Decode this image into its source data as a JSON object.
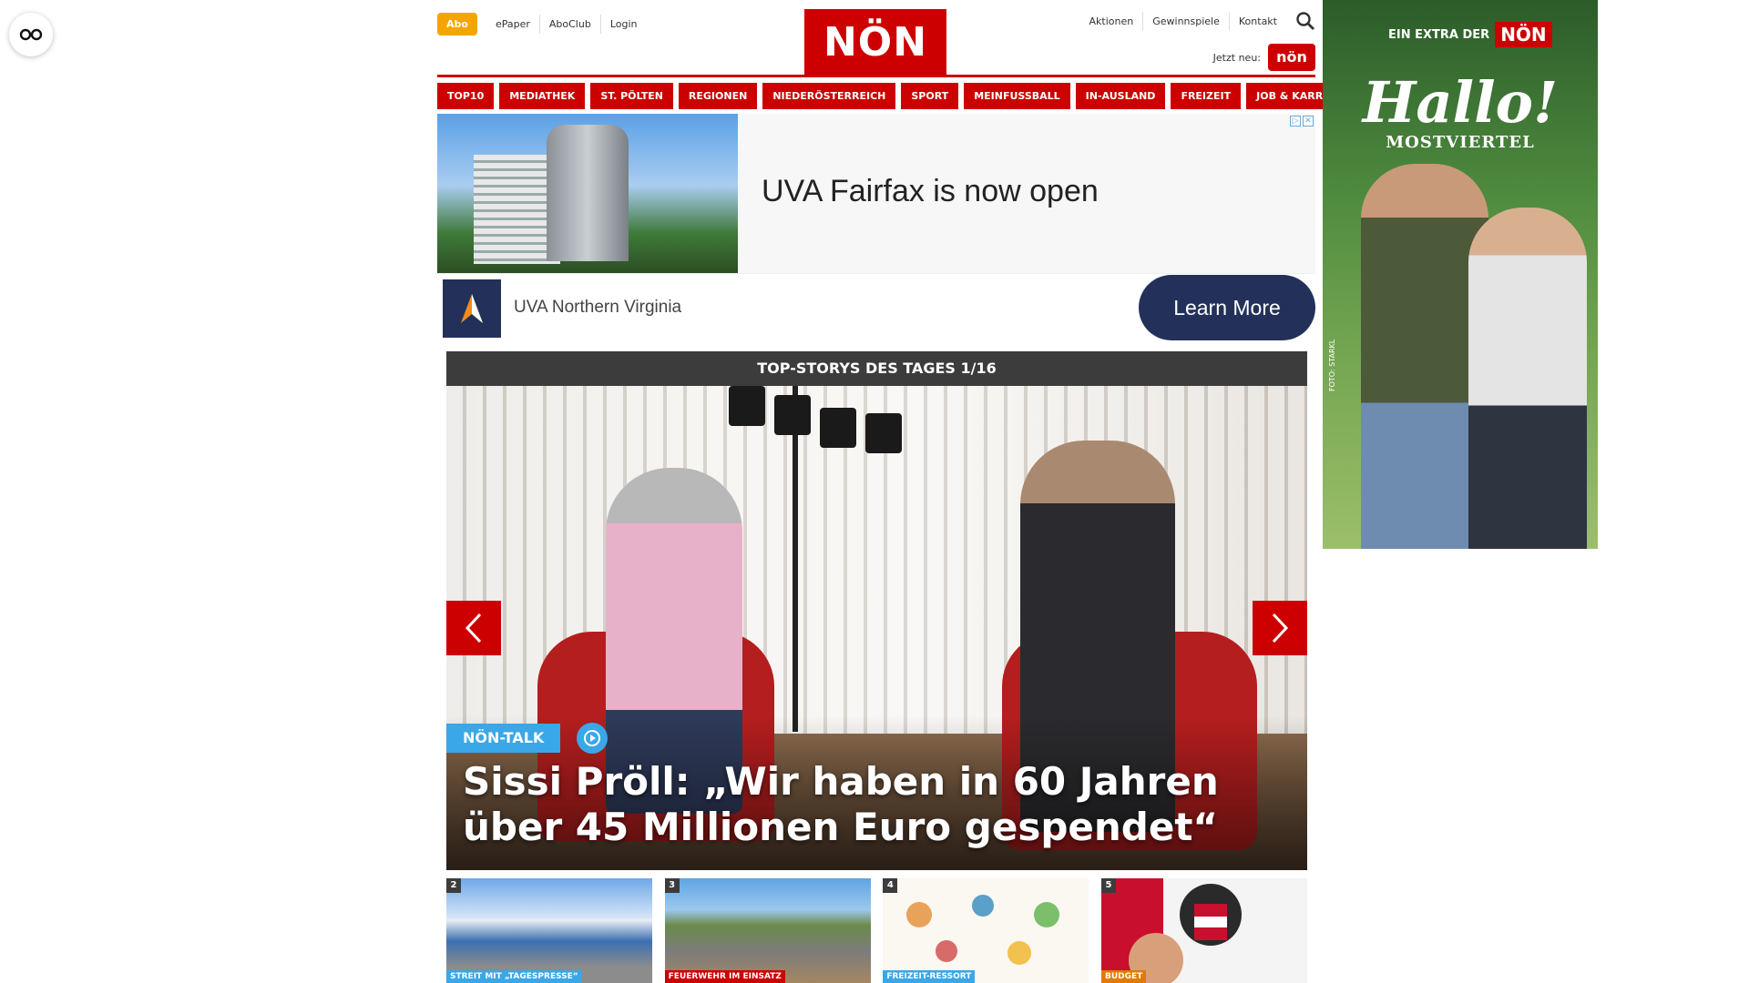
{
  "topbar": {
    "abo": "Abo",
    "links": [
      "ePaper",
      "AboClub",
      "Login"
    ],
    "logo": "NÖN",
    "right_links": [
      "Aktionen",
      "Gewinnspiele",
      "Kontakt"
    ],
    "jetzt_neu": "Jetzt neu:",
    "jetzt_badge": "nön"
  },
  "nav": [
    "TOP10",
    "MEDIATHEK",
    "ST. PÖLTEN",
    "REGIONEN",
    "NIEDERÖSTERREICH",
    "SPORT",
    "MEINFUSSBALL",
    "IN-AUSLAND",
    "FREIZEIT",
    "JOB & KARRIERE"
  ],
  "ad": {
    "headline": "UVA Fairfax is now open",
    "brand": "UVA Northern Virginia",
    "cta": "Learn More"
  },
  "hero": {
    "header": "TOP-STORYS DES TAGES 1/16",
    "badge": "NÖN-TALK",
    "title": "Sissi Pröll: „Wir haben in 60 Jahren über 45 Millionen Euro gespendet“"
  },
  "teasers": [
    {
      "num": "2",
      "tag": "STREIT MIT „TAGESPRESSE“",
      "tag_color": "#3aa7e8"
    },
    {
      "num": "3",
      "tag": "FEUERWEHR IM EINSATZ",
      "tag_color": "#cc0000"
    },
    {
      "num": "4",
      "tag": "FREIZEIT-RESSORT",
      "tag_color": "#3aa7e8"
    },
    {
      "num": "5",
      "tag": "BUDGET",
      "tag_color": "#e07b00"
    }
  ],
  "side_ad": {
    "extra": "EIN EXTRA DER",
    "extra_brand": "NÖN",
    "hallo": "Hallo!",
    "sub": "MOSTVIERTEL",
    "foto": "FOTO: STARKL"
  },
  "colors": {
    "brand_red": "#cc0000",
    "abo_orange": "#f5a500",
    "accent_blue": "#3aa7e8",
    "ad_navy": "#23315a"
  }
}
